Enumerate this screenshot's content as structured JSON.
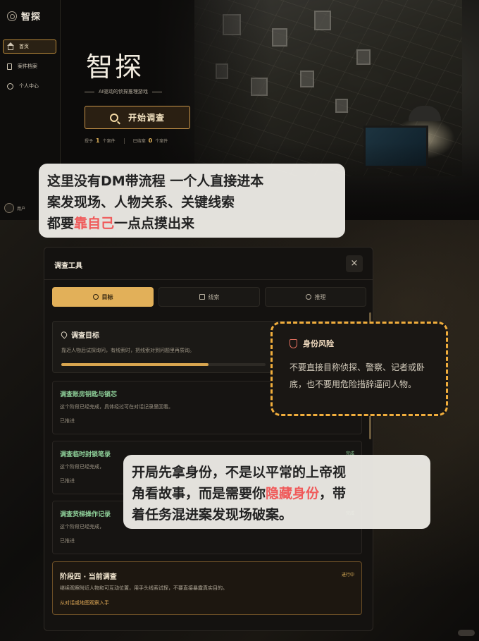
{
  "app": {
    "logo_text": "智探",
    "nav": [
      {
        "label": "首页",
        "icon": "home-icon",
        "active": true
      },
      {
        "label": "案件档案",
        "icon": "file-icon",
        "active": false
      },
      {
        "label": "个人中心",
        "icon": "user-icon",
        "active": false
      }
    ],
    "user_label": "用户"
  },
  "hero": {
    "title": "智探",
    "subtitle": "AI驱动的侦探推理游戏",
    "start_button": "开始调查",
    "stats": {
      "taken_label": "授予",
      "taken_value": "1",
      "taken_unit": "个案件",
      "closed_label": "已结案",
      "closed_value": "0",
      "closed_unit": "个案件"
    }
  },
  "note1": {
    "line1": "这里没有DM带流程 一个人直接进本",
    "line2": "案发现场、人物关系、关键线索",
    "line3_pre": "都要",
    "line3_hl": "靠自己",
    "line3_post": "一点点摸出来"
  },
  "panel": {
    "title": "调查工具",
    "close": "×",
    "tabs": [
      {
        "label": "目标",
        "active": true
      },
      {
        "label": "线索",
        "active": false
      },
      {
        "label": "推理",
        "active": false
      }
    ],
    "goal": {
      "title": "调查目标",
      "desc": "靠近人物后试探询问，有线索时，把线索对到问题里再质询。",
      "progress": 0.72
    },
    "stages": [
      {
        "title": "调查账房钥匙与锁芯",
        "desc": "这个阶段已经完成，具体经过可在对话记录里回看。",
        "state": "已推进",
        "badge": ""
      },
      {
        "title": "调查临时封锁笔录",
        "desc": "这个阶段已经完成，",
        "state": "已推进",
        "badge": "完成"
      },
      {
        "title": "调查货梯操作记录",
        "desc": "这个阶段已经完成，",
        "state": "已推进",
        "badge": "完成"
      }
    ],
    "current": {
      "title": "阶段四 · 当前调查",
      "badge": "进行中",
      "desc": "继续观察附近人物和可互动位置，用手头线索试探，不要直接暴露真实目的。",
      "hint": "从对话或地图观察入手"
    }
  },
  "risk": {
    "title": "身份风险",
    "text": "不要直接目称侦探、警察、记者或卧底，也不要用危险措辞逼问人物。"
  },
  "note2": {
    "line1": "开局先拿身份，不是以平常的上帝视",
    "line2_pre": "角看故事，而是需要你",
    "line2_hl": "隐藏身份",
    "line2_post": "，带",
    "line3": "着任务混进案发现场破案。"
  },
  "colors": {
    "accent": "#e2b059",
    "done_green": "#8fd19a",
    "highlight_red": "#f05a5a",
    "dashed_orange": "#f0ad3c"
  }
}
